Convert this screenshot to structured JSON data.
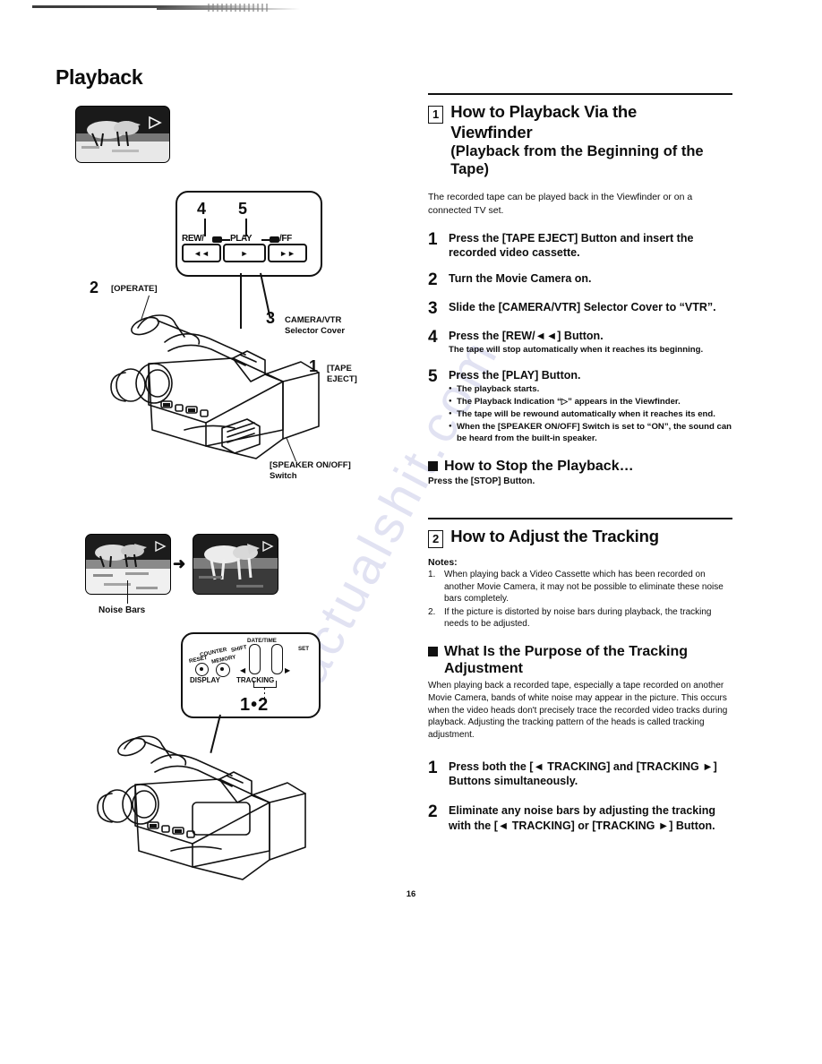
{
  "page": {
    "title": "Playback",
    "number": "16",
    "watermark_text": "actualshit.com"
  },
  "section1": {
    "number": "1",
    "title_line1": "How to Playback Via the",
    "title_line2": "Viewfinder",
    "subtitle_line1": "(Playback from the Beginning of the",
    "subtitle_line2": "Tape)",
    "intro_line1": "The recorded tape can be played back in the Viewfinder or on a",
    "intro_line2": "connected TV set.",
    "steps": [
      {
        "num": "1",
        "text": "Press the [TAPE EJECT] Button and insert the recorded video cassette."
      },
      {
        "num": "2",
        "text": "Turn the Movie Camera on."
      },
      {
        "num": "3",
        "text": "Slide the [CAMERA/VTR] Selector Cover to “VTR”."
      },
      {
        "num": "4",
        "text": "Press the [REW/◄◄] Button.",
        "sub": "The tape will stop automatically when it reaches its beginning."
      },
      {
        "num": "5",
        "text": "Press the [PLAY] Button.",
        "bullets": [
          "The playback starts.",
          "The Playback Indication “▷” appears in the Viewfinder.",
          "The tape will be rewound automatically when it reaches its end.",
          "When the [SPEAKER ON/OFF] Switch is set to “ON”, the sound can be heard from the built-in speaker."
        ]
      }
    ],
    "stop_heading": "How to Stop the Playback…",
    "stop_text": "Press the [STOP] Button."
  },
  "section2": {
    "number": "2",
    "title": "How to Adjust the Tracking",
    "notes_label": "Notes:",
    "notes": [
      {
        "n": "1.",
        "text": "When playing back a Video Cassette which has been recorded on another Movie Camera, it may not be possible to eliminate these noise bars completely."
      },
      {
        "n": "2.",
        "text": "If the picture is distorted by noise bars during playback, the tracking needs to be adjusted."
      }
    ],
    "purpose_heading_line1": "What Is the Purpose of the Tracking",
    "purpose_heading_line2": "Adjustment",
    "purpose_text": "When playing back a recorded tape, especially a tape recorded on another Movie Camera, bands of white noise may appear in the picture. This occurs when the video heads don't precisely trace the recorded video tracks during playback. Adjusting the tracking pattern of the heads is called tracking adjustment.",
    "steps": [
      {
        "num": "1",
        "text": "Press both the [◄ TRACKING] and [TRACKING ►] Buttons simultaneously."
      },
      {
        "num": "2",
        "text": "Eliminate any noise bars by adjusting the tracking with the [◄ TRACKING] or [TRACKING ►] Button."
      }
    ]
  },
  "diagram_top": {
    "viewfinder_caption": "",
    "play_indicator": "▷",
    "callout_numbers": {
      "rew": "4",
      "play": "5"
    },
    "transport_labels": {
      "rew": "REW/",
      "play": "PLAY",
      "ff": "/FF",
      "rew_glyph": "◄◄",
      "play_glyph": "►",
      "ff_glyph": "►►"
    },
    "camera_labels": [
      {
        "num": "2",
        "text": "[OPERATE]"
      },
      {
        "num": "3",
        "text": "CAMERA/VTR\nSelector Cover"
      },
      {
        "num": "1",
        "text": "[TAPE\nEJECT]"
      }
    ],
    "speaker_label": "[SPEAKER ON/OFF]\nSwitch"
  },
  "diagram_bottom": {
    "noise_label": "Noise Bars",
    "arrow": "➜",
    "play_indicator": "▷",
    "panel_labels": {
      "counter": "COUNTER",
      "reset": "RESET",
      "memory": "MEMORY",
      "shift": "SHIFT",
      "datetime": "DATE/TIME",
      "set": "SET",
      "display": "DISPLAY",
      "tracking": "TRACKING"
    },
    "callout_number": "1•2"
  }
}
